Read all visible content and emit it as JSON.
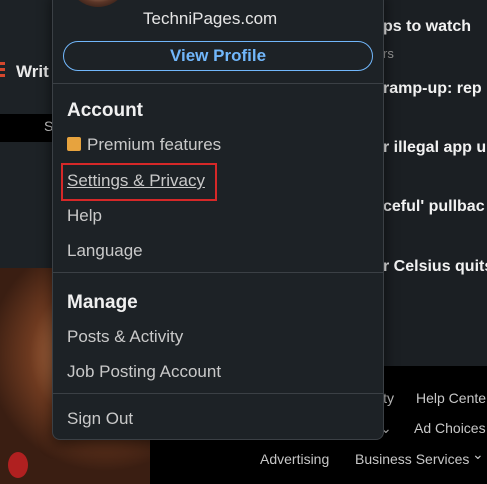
{
  "background": {
    "write_label": "Writ",
    "search_fragment": "S",
    "news": [
      "ps to watch",
      "rs",
      "ramp-up: rep",
      "r illegal app u",
      "ceful' pullbac",
      "r Celsius quits"
    ],
    "footer": {
      "links": [
        "ity",
        "Help Cente",
        "Ad Choices",
        "Advertising",
        "Business Services"
      ]
    }
  },
  "menu": {
    "site_name": "TechniPages.com",
    "view_profile": "View Profile",
    "account": {
      "title": "Account",
      "items": [
        "Premium features",
        "Settings & Privacy",
        "Help",
        "Language"
      ]
    },
    "manage": {
      "title": "Manage",
      "items": [
        "Posts & Activity",
        "Job Posting Account"
      ]
    },
    "sign_out": "Sign Out"
  },
  "colors": {
    "accent": "#71b7fb",
    "highlight": "#d62828",
    "premium": "#e7a33e"
  }
}
